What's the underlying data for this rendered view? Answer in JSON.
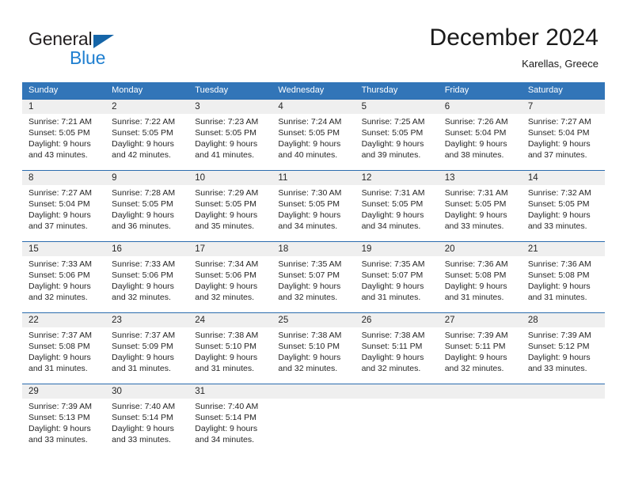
{
  "logo": {
    "word1": "General",
    "word2": "Blue",
    "triangle_color": "#1565a8",
    "word1_color": "#231f20",
    "word2_color": "#1f7fd0"
  },
  "header": {
    "month_title": "December 2024",
    "location": "Karellas, Greece"
  },
  "theme": {
    "header_blue": "#3275b8",
    "rule_blue": "#2b6cae",
    "band_gray": "#efefef"
  },
  "weekdays": [
    "Sunday",
    "Monday",
    "Tuesday",
    "Wednesday",
    "Thursday",
    "Friday",
    "Saturday"
  ],
  "weeks": [
    [
      {
        "day": "1",
        "sunrise": "Sunrise: 7:21 AM",
        "sunset": "Sunset: 5:05 PM",
        "daylight1": "Daylight: 9 hours",
        "daylight2": "and 43 minutes."
      },
      {
        "day": "2",
        "sunrise": "Sunrise: 7:22 AM",
        "sunset": "Sunset: 5:05 PM",
        "daylight1": "Daylight: 9 hours",
        "daylight2": "and 42 minutes."
      },
      {
        "day": "3",
        "sunrise": "Sunrise: 7:23 AM",
        "sunset": "Sunset: 5:05 PM",
        "daylight1": "Daylight: 9 hours",
        "daylight2": "and 41 minutes."
      },
      {
        "day": "4",
        "sunrise": "Sunrise: 7:24 AM",
        "sunset": "Sunset: 5:05 PM",
        "daylight1": "Daylight: 9 hours",
        "daylight2": "and 40 minutes."
      },
      {
        "day": "5",
        "sunrise": "Sunrise: 7:25 AM",
        "sunset": "Sunset: 5:05 PM",
        "daylight1": "Daylight: 9 hours",
        "daylight2": "and 39 minutes."
      },
      {
        "day": "6",
        "sunrise": "Sunrise: 7:26 AM",
        "sunset": "Sunset: 5:04 PM",
        "daylight1": "Daylight: 9 hours",
        "daylight2": "and 38 minutes."
      },
      {
        "day": "7",
        "sunrise": "Sunrise: 7:27 AM",
        "sunset": "Sunset: 5:04 PM",
        "daylight1": "Daylight: 9 hours",
        "daylight2": "and 37 minutes."
      }
    ],
    [
      {
        "day": "8",
        "sunrise": "Sunrise: 7:27 AM",
        "sunset": "Sunset: 5:04 PM",
        "daylight1": "Daylight: 9 hours",
        "daylight2": "and 37 minutes."
      },
      {
        "day": "9",
        "sunrise": "Sunrise: 7:28 AM",
        "sunset": "Sunset: 5:05 PM",
        "daylight1": "Daylight: 9 hours",
        "daylight2": "and 36 minutes."
      },
      {
        "day": "10",
        "sunrise": "Sunrise: 7:29 AM",
        "sunset": "Sunset: 5:05 PM",
        "daylight1": "Daylight: 9 hours",
        "daylight2": "and 35 minutes."
      },
      {
        "day": "11",
        "sunrise": "Sunrise: 7:30 AM",
        "sunset": "Sunset: 5:05 PM",
        "daylight1": "Daylight: 9 hours",
        "daylight2": "and 34 minutes."
      },
      {
        "day": "12",
        "sunrise": "Sunrise: 7:31 AM",
        "sunset": "Sunset: 5:05 PM",
        "daylight1": "Daylight: 9 hours",
        "daylight2": "and 34 minutes."
      },
      {
        "day": "13",
        "sunrise": "Sunrise: 7:31 AM",
        "sunset": "Sunset: 5:05 PM",
        "daylight1": "Daylight: 9 hours",
        "daylight2": "and 33 minutes."
      },
      {
        "day": "14",
        "sunrise": "Sunrise: 7:32 AM",
        "sunset": "Sunset: 5:05 PM",
        "daylight1": "Daylight: 9 hours",
        "daylight2": "and 33 minutes."
      }
    ],
    [
      {
        "day": "15",
        "sunrise": "Sunrise: 7:33 AM",
        "sunset": "Sunset: 5:06 PM",
        "daylight1": "Daylight: 9 hours",
        "daylight2": "and 32 minutes."
      },
      {
        "day": "16",
        "sunrise": "Sunrise: 7:33 AM",
        "sunset": "Sunset: 5:06 PM",
        "daylight1": "Daylight: 9 hours",
        "daylight2": "and 32 minutes."
      },
      {
        "day": "17",
        "sunrise": "Sunrise: 7:34 AM",
        "sunset": "Sunset: 5:06 PM",
        "daylight1": "Daylight: 9 hours",
        "daylight2": "and 32 minutes."
      },
      {
        "day": "18",
        "sunrise": "Sunrise: 7:35 AM",
        "sunset": "Sunset: 5:07 PM",
        "daylight1": "Daylight: 9 hours",
        "daylight2": "and 32 minutes."
      },
      {
        "day": "19",
        "sunrise": "Sunrise: 7:35 AM",
        "sunset": "Sunset: 5:07 PM",
        "daylight1": "Daylight: 9 hours",
        "daylight2": "and 31 minutes."
      },
      {
        "day": "20",
        "sunrise": "Sunrise: 7:36 AM",
        "sunset": "Sunset: 5:08 PM",
        "daylight1": "Daylight: 9 hours",
        "daylight2": "and 31 minutes."
      },
      {
        "day": "21",
        "sunrise": "Sunrise: 7:36 AM",
        "sunset": "Sunset: 5:08 PM",
        "daylight1": "Daylight: 9 hours",
        "daylight2": "and 31 minutes."
      }
    ],
    [
      {
        "day": "22",
        "sunrise": "Sunrise: 7:37 AM",
        "sunset": "Sunset: 5:08 PM",
        "daylight1": "Daylight: 9 hours",
        "daylight2": "and 31 minutes."
      },
      {
        "day": "23",
        "sunrise": "Sunrise: 7:37 AM",
        "sunset": "Sunset: 5:09 PM",
        "daylight1": "Daylight: 9 hours",
        "daylight2": "and 31 minutes."
      },
      {
        "day": "24",
        "sunrise": "Sunrise: 7:38 AM",
        "sunset": "Sunset: 5:10 PM",
        "daylight1": "Daylight: 9 hours",
        "daylight2": "and 31 minutes."
      },
      {
        "day": "25",
        "sunrise": "Sunrise: 7:38 AM",
        "sunset": "Sunset: 5:10 PM",
        "daylight1": "Daylight: 9 hours",
        "daylight2": "and 32 minutes."
      },
      {
        "day": "26",
        "sunrise": "Sunrise: 7:38 AM",
        "sunset": "Sunset: 5:11 PM",
        "daylight1": "Daylight: 9 hours",
        "daylight2": "and 32 minutes."
      },
      {
        "day": "27",
        "sunrise": "Sunrise: 7:39 AM",
        "sunset": "Sunset: 5:11 PM",
        "daylight1": "Daylight: 9 hours",
        "daylight2": "and 32 minutes."
      },
      {
        "day": "28",
        "sunrise": "Sunrise: 7:39 AM",
        "sunset": "Sunset: 5:12 PM",
        "daylight1": "Daylight: 9 hours",
        "daylight2": "and 33 minutes."
      }
    ],
    [
      {
        "day": "29",
        "sunrise": "Sunrise: 7:39 AM",
        "sunset": "Sunset: 5:13 PM",
        "daylight1": "Daylight: 9 hours",
        "daylight2": "and 33 minutes."
      },
      {
        "day": "30",
        "sunrise": "Sunrise: 7:40 AM",
        "sunset": "Sunset: 5:14 PM",
        "daylight1": "Daylight: 9 hours",
        "daylight2": "and 33 minutes."
      },
      {
        "day": "31",
        "sunrise": "Sunrise: 7:40 AM",
        "sunset": "Sunset: 5:14 PM",
        "daylight1": "Daylight: 9 hours",
        "daylight2": "and 34 minutes."
      },
      {
        "day": "",
        "sunrise": "",
        "sunset": "",
        "daylight1": "",
        "daylight2": ""
      },
      {
        "day": "",
        "sunrise": "",
        "sunset": "",
        "daylight1": "",
        "daylight2": ""
      },
      {
        "day": "",
        "sunrise": "",
        "sunset": "",
        "daylight1": "",
        "daylight2": ""
      },
      {
        "day": "",
        "sunrise": "",
        "sunset": "",
        "daylight1": "",
        "daylight2": ""
      }
    ]
  ]
}
